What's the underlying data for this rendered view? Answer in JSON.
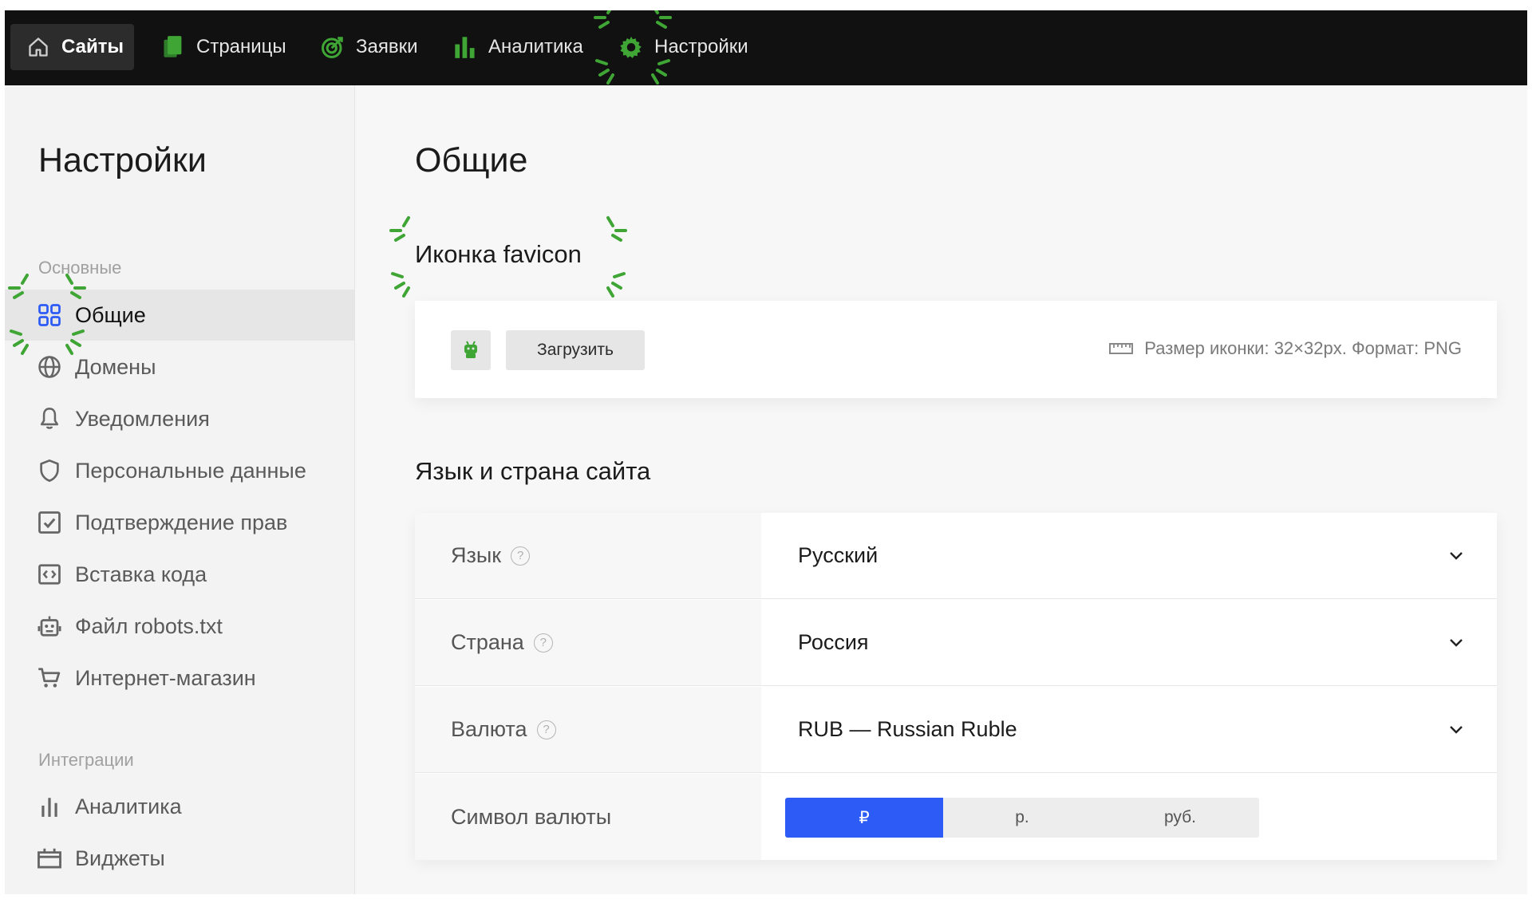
{
  "topnav": {
    "items": [
      {
        "label": "Сайты",
        "icon": "home-icon"
      },
      {
        "label": "Страницы",
        "icon": "pages-icon"
      },
      {
        "label": "Заявки",
        "icon": "target-icon"
      },
      {
        "label": "Аналитика",
        "icon": "bar-chart-icon"
      },
      {
        "label": "Настройки",
        "icon": "gear-icon"
      }
    ]
  },
  "sidebar": {
    "title": "Настройки",
    "sections": [
      {
        "label": "Основные",
        "items": [
          {
            "label": "Общие",
            "icon": "grid-icon",
            "active": true
          },
          {
            "label": "Домены",
            "icon": "globe-icon"
          },
          {
            "label": "Уведомления",
            "icon": "bell-icon"
          },
          {
            "label": "Персональные данные",
            "icon": "shield-icon"
          },
          {
            "label": "Подтверждение прав",
            "icon": "checkbox-icon"
          },
          {
            "label": "Вставка кода",
            "icon": "code-icon"
          },
          {
            "label": "Файл robots.txt",
            "icon": "robot-icon"
          },
          {
            "label": "Интернет-магазин",
            "icon": "cart-icon"
          }
        ]
      },
      {
        "label": "Интеграции",
        "items": [
          {
            "label": "Аналитика",
            "icon": "bar-chart-icon"
          },
          {
            "label": "Виджеты",
            "icon": "widget-icon"
          }
        ]
      }
    ]
  },
  "main": {
    "title": "Общие",
    "favicon": {
      "heading": "Иконка favicon",
      "upload_label": "Загрузить",
      "hint": "Размер иконки: 32×32px. Формат: PNG"
    },
    "language": {
      "heading": "Язык и страна сайта",
      "rows": [
        {
          "label": "Язык",
          "value": "Русский"
        },
        {
          "label": "Страна",
          "value": "Россия"
        },
        {
          "label": "Валюта",
          "value": "RUB — Russian Ruble"
        }
      ],
      "currency_symbol": {
        "label": "Символ валюты",
        "options": [
          "₽",
          "р.",
          "руб."
        ],
        "selected": "₽"
      }
    }
  },
  "colors": {
    "accent_green": "#3fa535",
    "selected_blue": "#2d5bf6",
    "topbar_bg": "#111111"
  }
}
